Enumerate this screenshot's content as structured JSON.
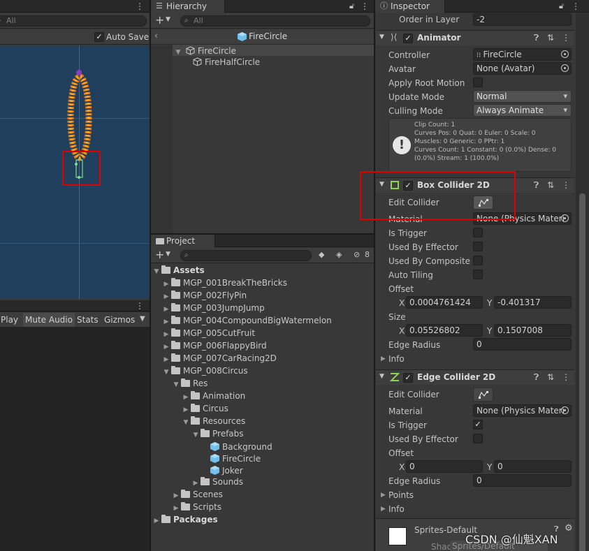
{
  "scene": {
    "search_placeholder": "All",
    "auto_save": "Auto Save",
    "game_buttons": [
      "Play",
      "Mute Audio",
      "Stats",
      "Gizmos"
    ]
  },
  "hierarchy": {
    "tab": "Hierarchy",
    "search_placeholder": "All",
    "prefab_title": "FireCircle",
    "items": [
      "FireCircle",
      "FireHalfCircle"
    ]
  },
  "project": {
    "tab": "Project",
    "hidden_count": "8",
    "assets_root": "Assets",
    "folders": [
      "MGP_001BreakTheBricks",
      "MGP_002FlyPin",
      "MGP_003JumpJump",
      "MGP_004CompoundBigWatermelon",
      "MGP_005CutFruit",
      "MGP_006FlappyBird",
      "MGP_007CarRacing2D",
      "MGP_008Circus"
    ],
    "res": "Res",
    "res_children": [
      "Animation",
      "Circus",
      "Resources"
    ],
    "prefabs": "Prefabs",
    "prefab_items": [
      "Background",
      "FireCircle",
      "Joker"
    ],
    "sounds": "Sounds",
    "scenes": "Scenes",
    "scripts": "Scripts",
    "packages": "Packages"
  },
  "inspector": {
    "tab": "Inspector",
    "order_in_layer_label": "Order in Layer",
    "order_in_layer_value": "-2",
    "animator": {
      "title": "Animator",
      "controller_label": "Controller",
      "controller_value": "FireCircle",
      "avatar_label": "Avatar",
      "avatar_value": "None (Avatar)",
      "apply_root_motion_label": "Apply Root Motion",
      "update_mode_label": "Update Mode",
      "update_mode_value": "Normal",
      "culling_mode_label": "Culling Mode",
      "culling_mode_value": "Always Animate",
      "info_lines": [
        "Clip Count: 1",
        "Curves Pos: 0 Quat: 0 Euler: 0 Scale: 0",
        "Muscles: 0 Generic: 0 PPtr: 1",
        "Curves Count: 1 Constant: 0 (0.0%) Dense: 0",
        "(0.0%) Stream: 1 (100.0%)"
      ]
    },
    "box_collider": {
      "title": "Box Collider 2D",
      "edit_collider": "Edit Collider",
      "material_label": "Material",
      "material_value": "None (Physics Materi",
      "is_trigger": "Is Trigger",
      "used_by_effector": "Used By Effector",
      "used_by_composite": "Used By Composite",
      "auto_tiling": "Auto Tiling",
      "offset_label": "Offset",
      "offset_x": "0.0004761424",
      "offset_y": "-0.401317",
      "size_label": "Size",
      "size_x": "0.05526802",
      "size_y": "0.1507008",
      "edge_radius_label": "Edge Radius",
      "edge_radius_value": "0",
      "info": "Info"
    },
    "edge_collider": {
      "title": "Edge Collider 2D",
      "edit_collider": "Edit Collider",
      "material_label": "Material",
      "material_value": "None (Physics Materi",
      "is_trigger": "Is Trigger",
      "used_by_effector": "Used By Effector",
      "offset_label": "Offset",
      "offset_x": "0",
      "offset_y": "0",
      "edge_radius_label": "Edge Radius",
      "edge_radius_value": "0",
      "points": "Points",
      "info": "Info"
    },
    "material": {
      "name": "Sprites-Default",
      "shader_label": "Shader",
      "shader_value": "Sprites/Default"
    },
    "x_label": "X",
    "y_label": "Y"
  },
  "watermark": "CSDN @仙魁XAN",
  "colors": {
    "scene_bg": "#1f3f5d",
    "highlight_red": "#e00000",
    "checkbox_green": "#8ed44e",
    "cube_blue": "#6fc0ef"
  }
}
